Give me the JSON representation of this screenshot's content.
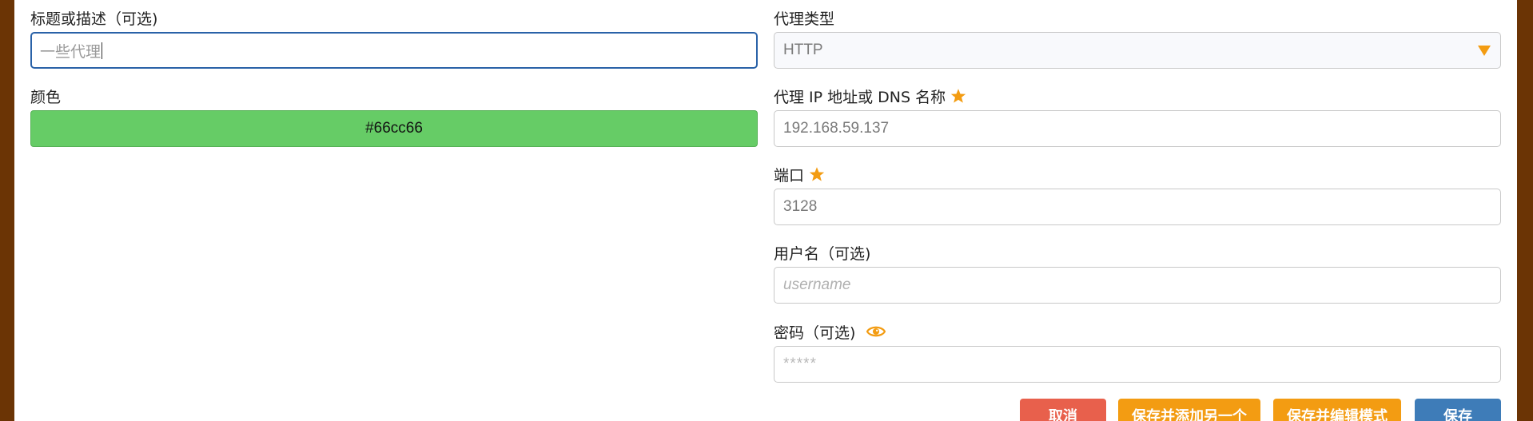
{
  "form": {
    "title_label": "标题或描述（可选)",
    "title_value": "一些代理",
    "color_label": "颜色",
    "color_value": "#66cc66",
    "proxy_type_label": "代理类型",
    "proxy_type_value": "HTTP",
    "host_label": "代理 IP 地址或 DNS 名称",
    "host_placeholder": "192.168.59.137",
    "port_label": "端口",
    "port_placeholder": "3128",
    "username_label": "用户名（可选)",
    "username_placeholder": "username",
    "password_label": "密码（可选)",
    "password_placeholder": "*****"
  },
  "buttons": {
    "cancel": "取消",
    "save_add": "保存并添加另一个",
    "save_edit": "保存并编辑模式",
    "save": "保存"
  },
  "colors": {
    "swatch": "#66cc66",
    "accent_orange": "#f39c12",
    "cancel_red": "#e8604c",
    "save_blue": "#3e7cb8",
    "focus_blue": "#2a62a8",
    "frame_brown": "#6b3405"
  },
  "icons": {
    "required": "star-icon",
    "toggle_password": "eye-icon",
    "dropdown": "caret-down-icon"
  }
}
